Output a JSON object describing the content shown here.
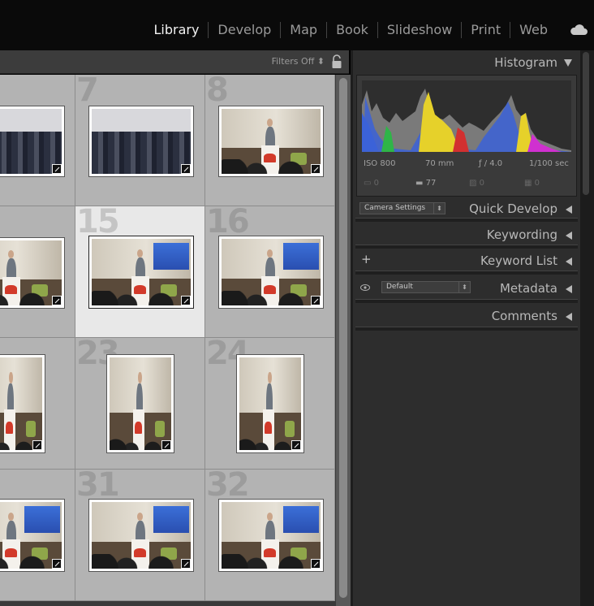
{
  "modules": [
    "Library",
    "Develop",
    "Map",
    "Book",
    "Slideshow",
    "Print",
    "Web"
  ],
  "active_module": "Library",
  "filter_bar": {
    "filters_label": "Filters Off"
  },
  "grid": {
    "cells": [
      {
        "number": "",
        "selected": false,
        "kind": "crowd"
      },
      {
        "number": "7",
        "selected": false,
        "kind": "crowd"
      },
      {
        "number": "8",
        "selected": false,
        "kind": "stage"
      },
      {
        "number": "",
        "selected": false,
        "kind": "stage"
      },
      {
        "number": "15",
        "selected": true,
        "kind": "stage-screen"
      },
      {
        "number": "16",
        "selected": false,
        "kind": "stage-screen"
      },
      {
        "number": "",
        "selected": false,
        "kind": "stage"
      },
      {
        "number": "23",
        "selected": false,
        "kind": "stage"
      },
      {
        "number": "24",
        "selected": false,
        "kind": "stage"
      },
      {
        "number": "",
        "selected": false,
        "kind": "stage-screen"
      },
      {
        "number": "31",
        "selected": false,
        "kind": "stage-screen"
      },
      {
        "number": "32",
        "selected": false,
        "kind": "stage-screen"
      }
    ]
  },
  "panel": {
    "histogram": {
      "title": "Histogram",
      "iso": "ISO 800",
      "focal": "70 mm",
      "aperture": "ƒ / 4.0",
      "shutter": "1/100 sec",
      "icon_values": [
        "0",
        "77",
        "0",
        "0"
      ]
    },
    "quick_develop": {
      "title": "Quick Develop",
      "preset": "Camera Settings"
    },
    "keywording": {
      "title": "Keywording"
    },
    "keyword_list": {
      "title": "Keyword List"
    },
    "metadata": {
      "title": "Metadata",
      "preset": "Default"
    },
    "comments": {
      "title": "Comments"
    }
  },
  "colors": {
    "background": "#2d2d2d",
    "grid_cell": "#b3b3b3",
    "selected_cell": "#e8e8e8",
    "active_module": "#f2f2f2"
  }
}
